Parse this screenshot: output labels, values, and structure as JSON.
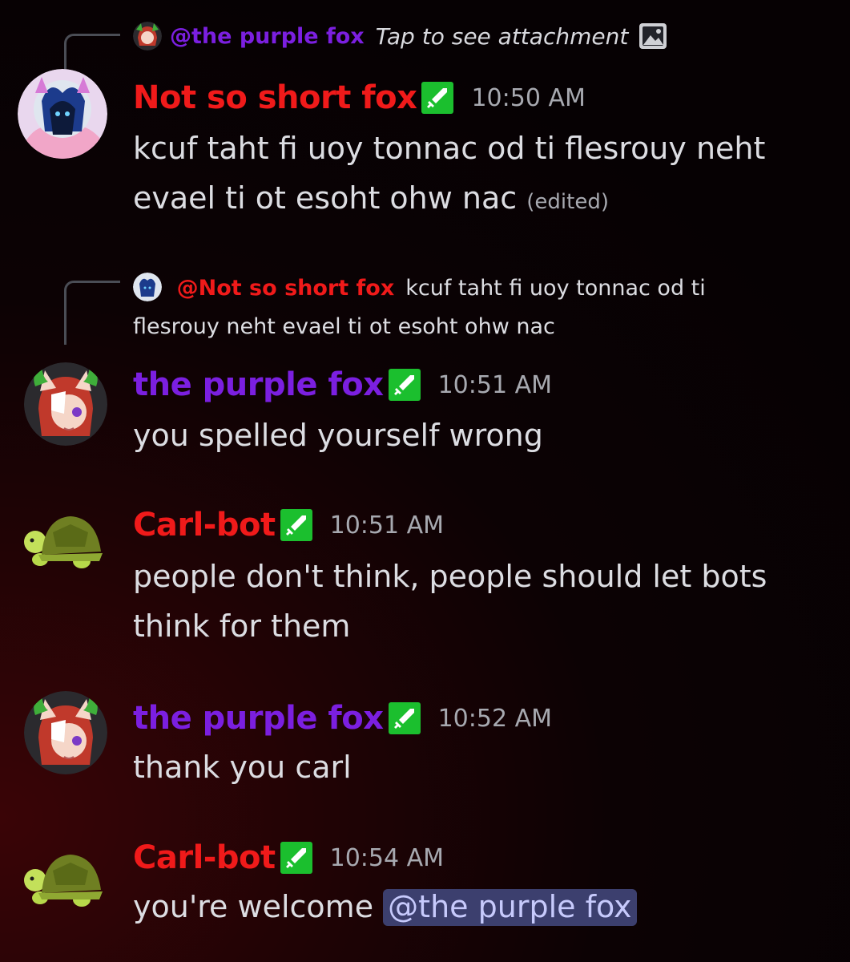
{
  "colors": {
    "red_user": "#f01a1a",
    "purple_user": "#7b1fe0",
    "badge_green": "#1bbf2e",
    "mention_bg": "#3c3f6e",
    "mention_text": "#c7cafc"
  },
  "reply1": {
    "avatar_icon": "fox-girl-avatar",
    "name": "@the purple fox",
    "text": "Tap to see attachment",
    "icon": "image-icon"
  },
  "msg1": {
    "avatar_icon": "blue-fox-avatar",
    "username": "Not so short fox",
    "badge_icon": "sword-badge-icon",
    "timestamp": "10:50 AM",
    "text": "kcuf taht fi uoy tonnac od ti flesrouy neht evael ti ot esoht ohw nac",
    "edited": "(edited)"
  },
  "reply2": {
    "avatar_icon": "blue-fox-avatar",
    "name": "@Not so short fox",
    "text": "kcuf taht fi uoy tonnac od ti flesrouy neht evael ti ot esoht ohw nac"
  },
  "msg2": {
    "avatar_icon": "fox-girl-avatar",
    "username": "the purple fox",
    "badge_icon": "sword-badge-icon",
    "timestamp": "10:51 AM",
    "text": "you spelled yourself wrong"
  },
  "msg3": {
    "avatar_icon": "turtle-avatar",
    "username": "Carl-bot",
    "badge_icon": "sword-badge-icon",
    "timestamp": "10:51 AM",
    "text": "people don't think, people should let bots think for them"
  },
  "msg4": {
    "avatar_icon": "fox-girl-avatar",
    "username": "the purple fox",
    "badge_icon": "sword-badge-icon",
    "timestamp": "10:52 AM",
    "text": "thank you carl"
  },
  "msg5": {
    "avatar_icon": "turtle-avatar",
    "username": "Carl-bot",
    "badge_icon": "sword-badge-icon",
    "timestamp": "10:54 AM",
    "text": "you're welcome",
    "mention": "@the purple fox"
  }
}
